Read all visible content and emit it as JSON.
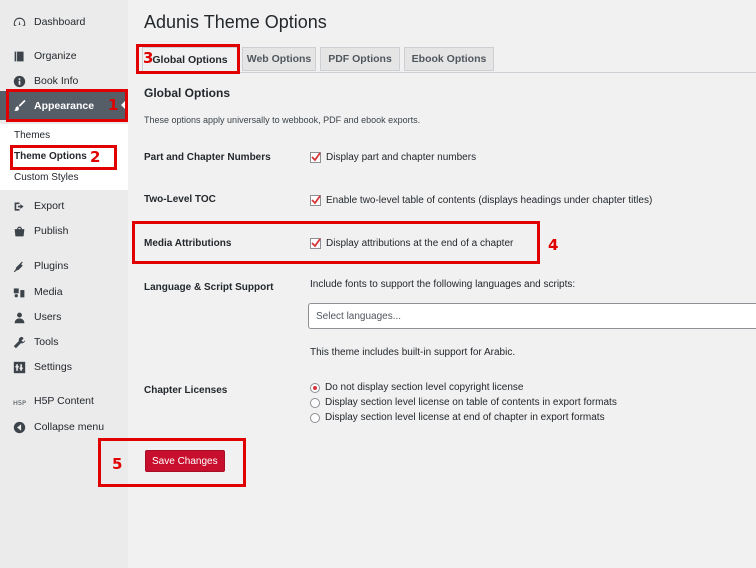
{
  "sidebar": {
    "items": [
      {
        "label": "Dashboard",
        "icon": "dashboard-icon"
      },
      {
        "label": "Organize",
        "icon": "book-icon"
      },
      {
        "label": "Book Info",
        "icon": "info-icon"
      },
      {
        "label": "Appearance",
        "icon": "brush-icon"
      },
      {
        "label": "Export",
        "icon": "export-icon"
      },
      {
        "label": "Publish",
        "icon": "store-icon"
      },
      {
        "label": "Plugins",
        "icon": "plugins-icon"
      },
      {
        "label": "Media",
        "icon": "media-icon"
      },
      {
        "label": "Users",
        "icon": "users-icon"
      },
      {
        "label": "Tools",
        "icon": "tools-icon"
      },
      {
        "label": "Settings",
        "icon": "settings-icon"
      },
      {
        "label": "H5P Content",
        "icon": "h5p-icon"
      },
      {
        "label": "Collapse menu",
        "icon": "collapse-icon"
      }
    ],
    "submenu": [
      "Themes",
      "Theme Options",
      "Custom Styles"
    ]
  },
  "page": {
    "title": "Adunis Theme Options",
    "tabs": [
      "Global Options",
      "Web Options",
      "PDF Options",
      "Ebook Options"
    ],
    "section_title": "Global Options",
    "section_desc": "These options apply universally to webbook, PDF and ebook exports."
  },
  "rows": {
    "numbers": {
      "label": "Part and Chapter Numbers",
      "option": "Display part and chapter numbers",
      "checked": true
    },
    "toc": {
      "label": "Two-Level TOC",
      "option": "Enable two-level table of contents (displays headings under chapter titles)",
      "checked": true
    },
    "media": {
      "label": "Media Attributions",
      "option": "Display attributions at the end of a chapter",
      "checked": true
    },
    "language": {
      "label": "Language & Script Support",
      "intro": "Include fonts to support the following languages and scripts:",
      "placeholder": "Select languages...",
      "note": "This theme includes built-in support for Arabic."
    },
    "licenses": {
      "label": "Chapter Licenses",
      "options": [
        "Do not display section level copyright license",
        "Display section level license on table of contents in export formats",
        "Display section level license at end of chapter in export formats"
      ],
      "selected": 0
    }
  },
  "save_label": "Save Changes",
  "annotations": [
    "1",
    "2",
    "3",
    "4",
    "5"
  ],
  "colors": {
    "accent": "#c8102e",
    "annotation": "#e00000",
    "active_nav": "#555d66"
  }
}
